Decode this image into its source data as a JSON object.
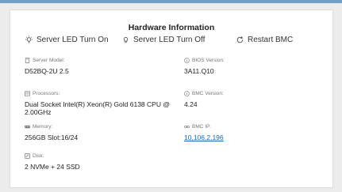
{
  "panel": {
    "title": "Hardware Information"
  },
  "actions": {
    "led_on": "Server LED Turn On",
    "led_off": "Server LED Turn Off",
    "restart": "Restart BMC"
  },
  "fields": {
    "server_model": {
      "label": "Server Model:",
      "value": "D52BQ-2U 2.5",
      "icon": "server-icon"
    },
    "bios_version": {
      "label": "BIOS Version:",
      "value": "3A11.Q10",
      "icon": "info-icon"
    },
    "processors": {
      "label": "Processors:",
      "value": "Dual Socket Intel(R) Xeon(R) Gold 6138 CPU @ 2.00GHz",
      "icon": "cpu-icon"
    },
    "bmc_version": {
      "label": "BMC Version:",
      "value": "4.24",
      "icon": "info-icon"
    },
    "memory": {
      "label": "Memory:",
      "value": "256GB Slot:16/24",
      "icon": "memory-icon"
    },
    "bmc_ip": {
      "label": "BMC IP:",
      "value": "10.106.2.196",
      "icon": "link-icon"
    },
    "disk": {
      "label": "Disk:",
      "value": "2 NVMe + 24 SSD",
      "icon": "disk-icon"
    }
  },
  "colors": {
    "accent": "#6f9fc7",
    "link": "#1a64b8"
  }
}
